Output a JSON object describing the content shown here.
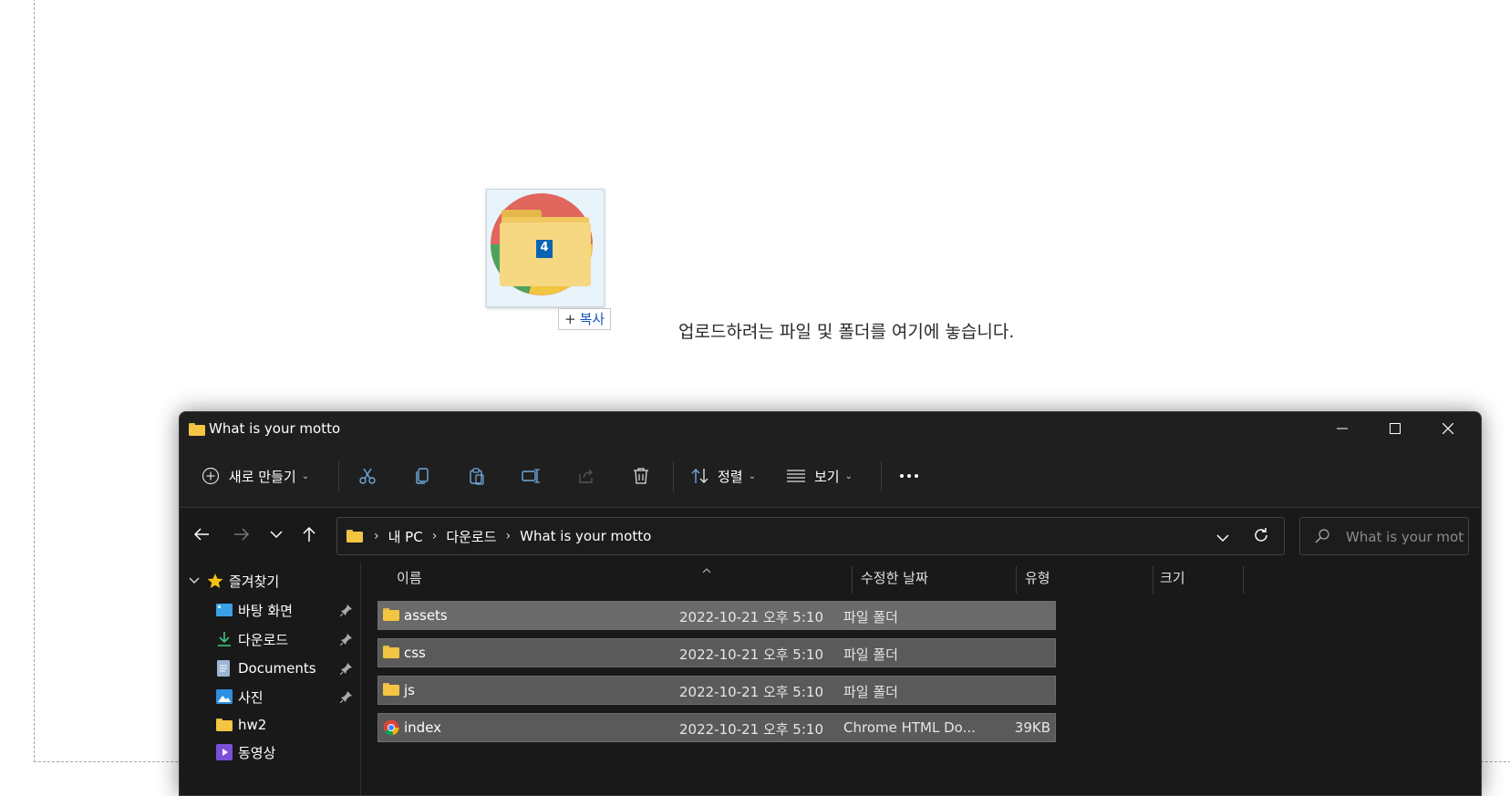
{
  "dropzone": {
    "hint_text": "업로드하려는 파일 및 폴더를 여기에 놓습니다.",
    "drag_count": "4",
    "copy_label": "복사"
  },
  "window": {
    "title": "What is your motto"
  },
  "toolbar": {
    "new_label": "새로 만들기",
    "sort_label": "정렬",
    "view_label": "보기"
  },
  "address": {
    "crumbs": [
      "내 PC",
      "다운로드",
      "What is your motto"
    ]
  },
  "search": {
    "placeholder": "What is your mott..."
  },
  "sidebar": {
    "favorites_label": "즐겨찾기",
    "items": [
      {
        "label": "바탕 화면",
        "icon": "desktop-icon",
        "pinned": true
      },
      {
        "label": "다운로드",
        "icon": "download-icon",
        "pinned": true
      },
      {
        "label": "Documents",
        "icon": "document-icon",
        "pinned": true
      },
      {
        "label": "사진",
        "icon": "pictures-icon",
        "pinned": true
      },
      {
        "label": "hw2",
        "icon": "folder-icon",
        "pinned": false
      },
      {
        "label": "동영상",
        "icon": "video-icon",
        "pinned": false
      }
    ]
  },
  "columns": {
    "name": "이름",
    "modified": "수정한 날짜",
    "type": "유형",
    "size": "크기"
  },
  "files": [
    {
      "name": "assets",
      "modified": "2022-10-21 오후 5:10",
      "type": "파일 폴더",
      "size": "",
      "icon": "folder-icon"
    },
    {
      "name": "css",
      "modified": "2022-10-21 오후 5:10",
      "type": "파일 폴더",
      "size": "",
      "icon": "folder-icon"
    },
    {
      "name": "js",
      "modified": "2022-10-21 오후 5:10",
      "type": "파일 폴더",
      "size": "",
      "icon": "folder-icon"
    },
    {
      "name": "index",
      "modified": "2022-10-21 오후 5:10",
      "type": "Chrome HTML Do...",
      "size": "39KB",
      "icon": "chrome-icon"
    }
  ],
  "colors": {
    "folder": "#f4c542",
    "window_bg": "#191919",
    "row_selected": "#5f5f5f",
    "accent_blue": "#0a64b4"
  }
}
